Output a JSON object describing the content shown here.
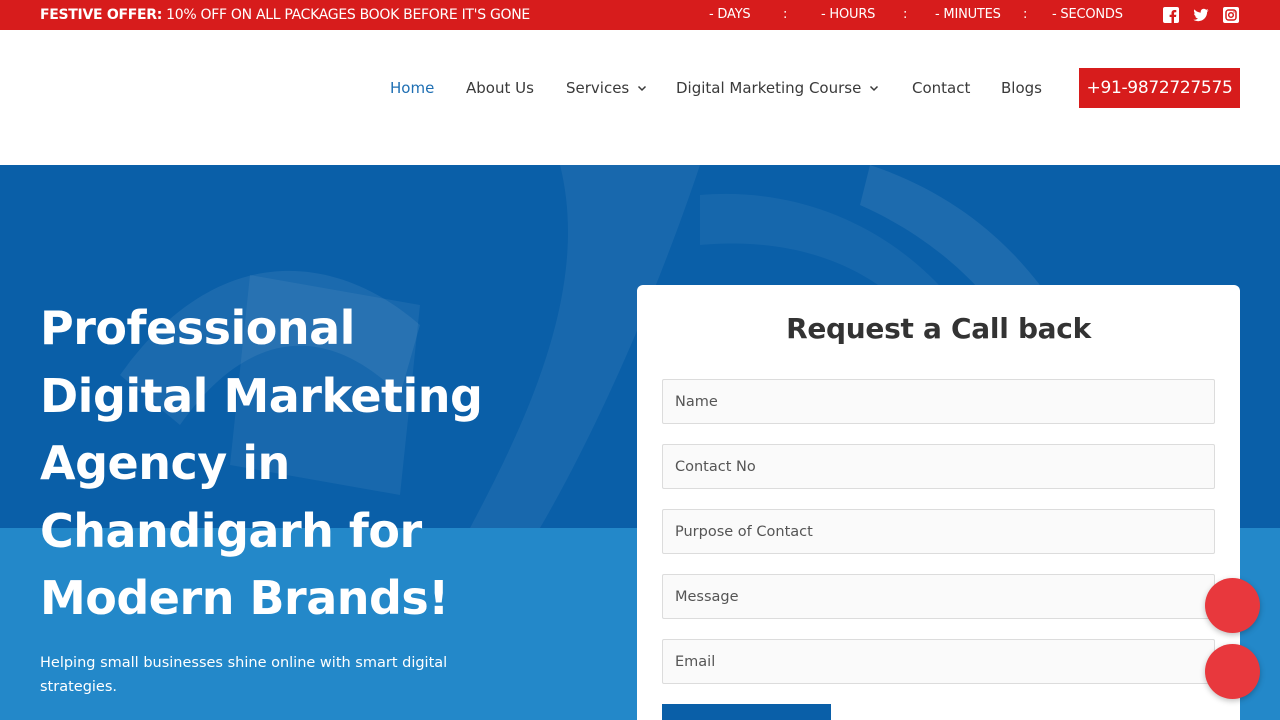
{
  "topbar": {
    "offer_bold": "FESTIVE OFFER:",
    "offer_text": " 10% OFF ON ALL PACKAGES BOOK BEFORE IT'S GONE",
    "countdown": {
      "days": "- DAYS",
      "hours": "- HOURS",
      "minutes": "- MINUTES",
      "seconds": "- SECONDS",
      "separator": ":"
    },
    "social_icons": [
      "facebook-icon",
      "twitter-icon",
      "instagram-icon"
    ]
  },
  "nav": {
    "items": [
      {
        "label": "Home",
        "active": true
      },
      {
        "label": "About Us"
      },
      {
        "label": "Services",
        "dropdown": true
      },
      {
        "label": "Digital Marketing Course",
        "dropdown": true
      },
      {
        "label": "Contact"
      },
      {
        "label": "Blogs"
      }
    ],
    "phone": "+91-9872727575"
  },
  "hero": {
    "title_lines": [
      "Professional",
      "Digital Marketing",
      "Agency in",
      "Chandigarh for",
      "Modern Brands!"
    ],
    "subtitle": "Helping small businesses shine online with smart digital strategies."
  },
  "form": {
    "title": "Request a Call back",
    "fields": {
      "name": "Name",
      "contact": "Contact No",
      "purpose": "Purpose of Contact",
      "message": "Message",
      "email": "Email"
    }
  },
  "colors": {
    "accent_red": "#d71c1c",
    "brand_blue": "#0a5fa8",
    "light_blue": "#2388c9",
    "nav_active": "#1e6fb3",
    "float_red": "#e8383d"
  }
}
